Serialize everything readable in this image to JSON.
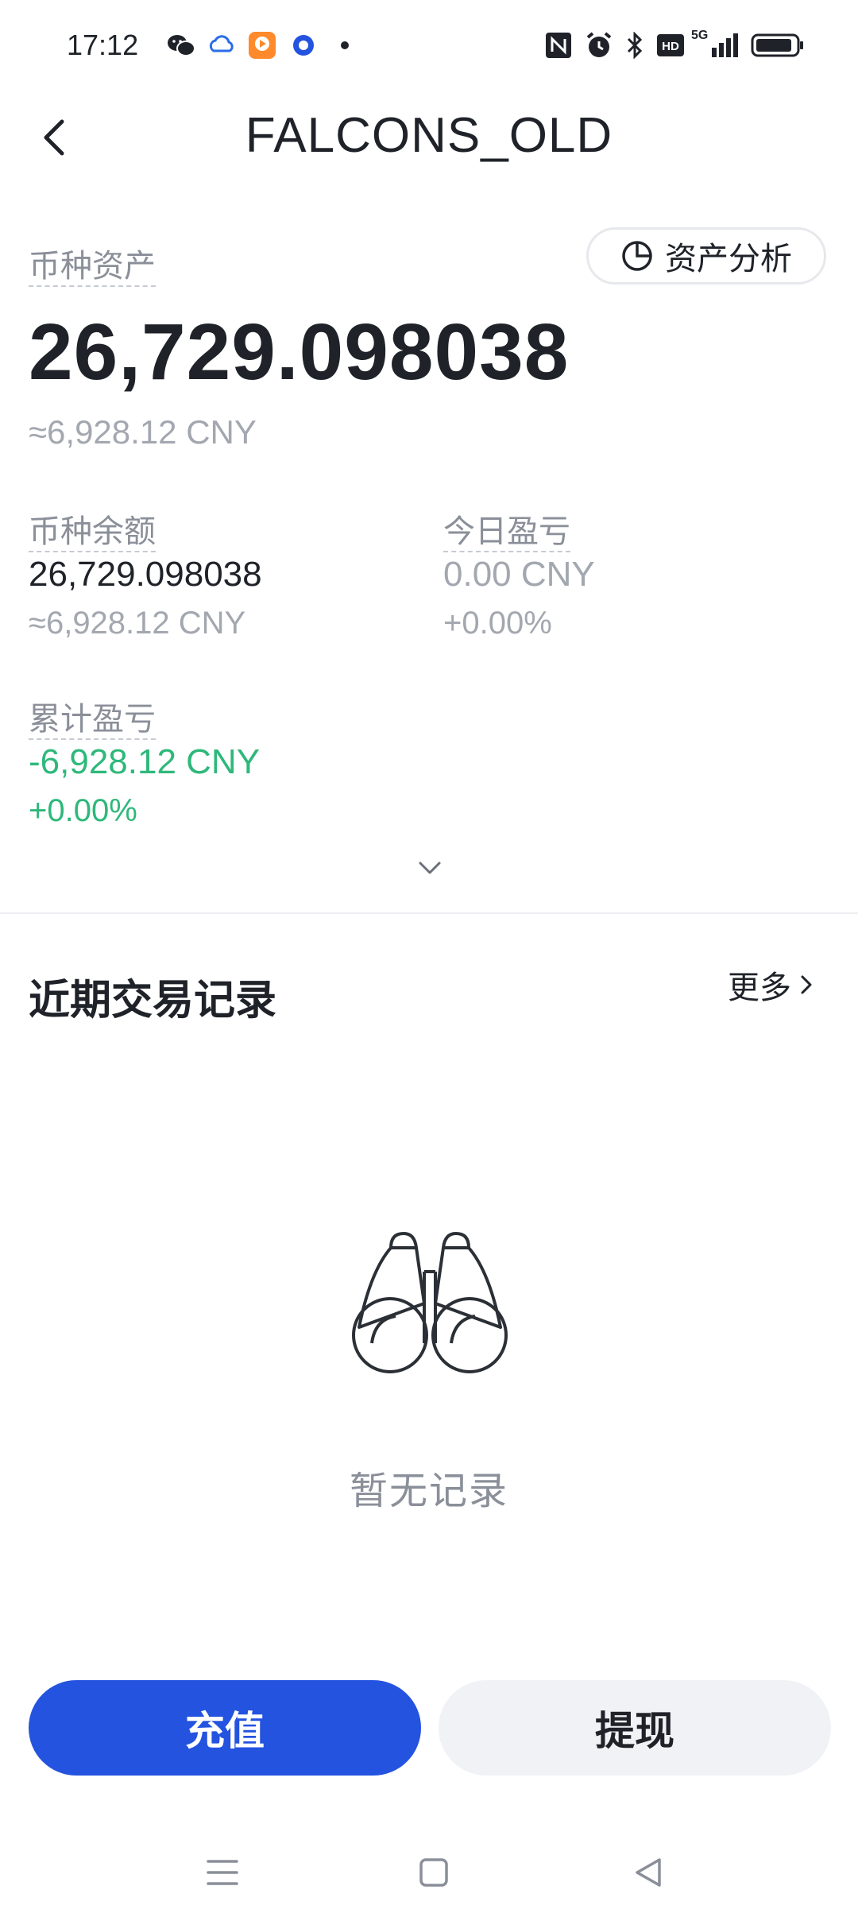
{
  "status_bar": {
    "time": "17:12",
    "icons": [
      "wechat-icon",
      "cloud-app-icon",
      "video-app-icon",
      "browser-app-icon",
      "more-dot-icon",
      "nfc-icon",
      "alarm-icon",
      "bluetooth-icon",
      "hd-icon",
      "signal-5g-icon",
      "battery-icon"
    ],
    "network": "5G",
    "hd_label": "HD"
  },
  "header": {
    "title": "FALCONS_OLD",
    "back_icon": "chevron-left-icon"
  },
  "asset": {
    "label": "币种资产",
    "value": "26,729.098038",
    "cny": "≈6,928.12 CNY",
    "analysis_button": "资产分析",
    "analysis_icon": "pie-chart-icon"
  },
  "stats": {
    "balance": {
      "label": "币种余额",
      "value": "26,729.098038",
      "sub": "≈6,928.12 CNY"
    },
    "today_pnl": {
      "label": "今日盈亏",
      "value": "0.00 CNY",
      "sub": "+0.00%"
    },
    "total_pnl": {
      "label": "累计盈亏",
      "value": "-6,928.12 CNY",
      "sub": "+0.00%"
    }
  },
  "records": {
    "title": "近期交易记录",
    "more": "更多",
    "empty_text": "暂无记录",
    "empty_icon": "binoculars-icon"
  },
  "actions": {
    "deposit": "充值",
    "withdraw": "提现"
  },
  "nav": [
    "menu-icon",
    "home-square-icon",
    "back-triangle-icon"
  ],
  "colors": {
    "primary": "#2453e0",
    "profit_green": "#2eb87a",
    "text_primary": "#1f2329",
    "text_secondary": "#8a8f99"
  }
}
